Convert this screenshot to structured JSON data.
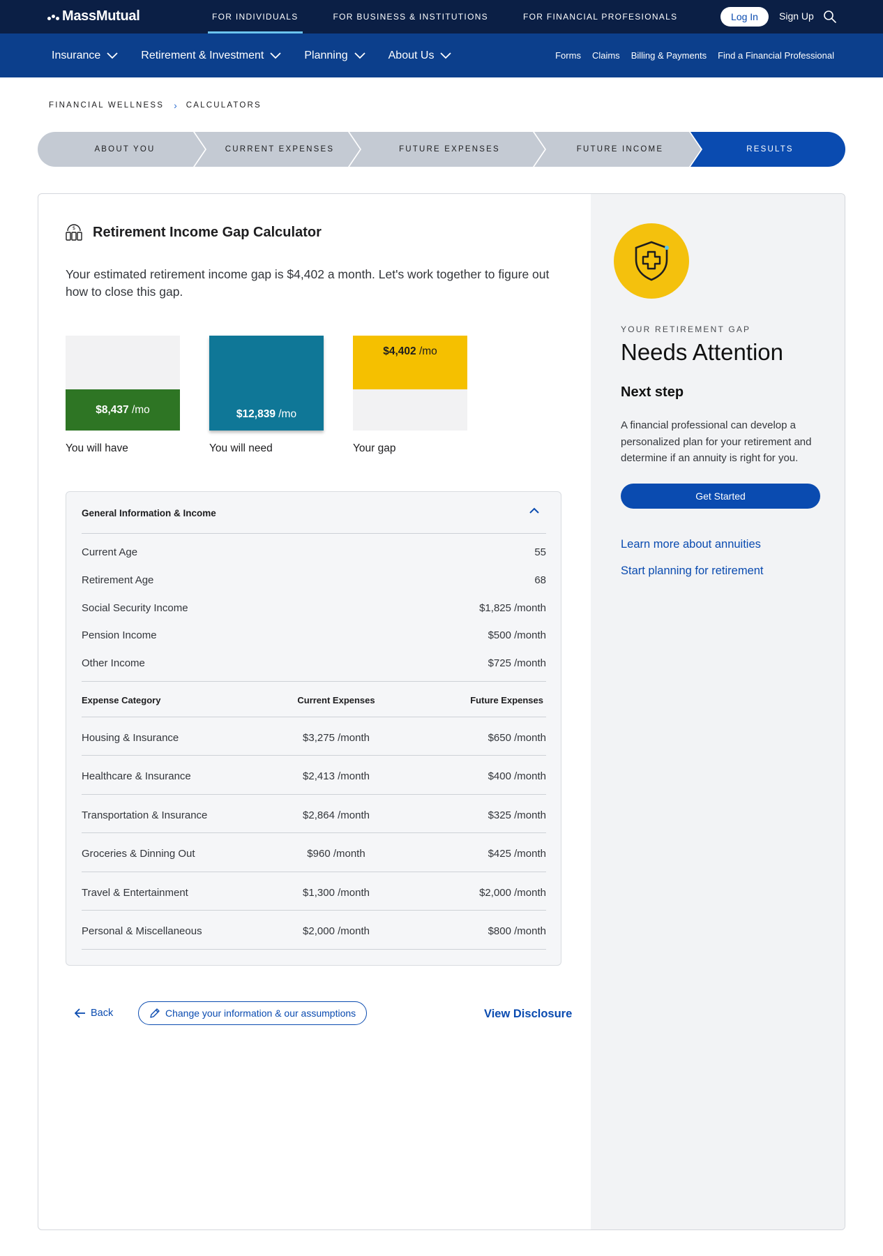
{
  "topbar": {
    "logo": "MassMutual",
    "segments": [
      {
        "label": "FOR INDIVIDUALS",
        "active": true
      },
      {
        "label": "FOR BUSINESS & INSTITUTIONS",
        "active": false
      },
      {
        "label": "FOR FINANCIAL PROFESIONALS",
        "active": false
      }
    ],
    "login_label": "Log In",
    "signup_label": "Sign Up",
    "search_icon": "search-icon"
  },
  "nav": {
    "menus": [
      "Insurance",
      "Retirement & Investment",
      "Planning",
      "About Us"
    ],
    "links": [
      "Forms",
      "Claims",
      "Billing & Payments",
      "Find a Financial Professional"
    ]
  },
  "breadcrumb": [
    "FINANCIAL WELLNESS",
    "CALCULATORS"
  ],
  "stepper": {
    "steps": [
      "ABOUT YOU",
      "CURRENT EXPENSES",
      "FUTURE EXPENSES",
      "FUTURE INCOME",
      "RESULTS"
    ],
    "current": "RESULTS"
  },
  "calculator": {
    "title": "Retirement Income Gap Calculator",
    "intro": "Your estimated retirement income gap is $4,402 a month. Let's work together to figure out how to close this gap.",
    "bars": [
      {
        "value": "$8,437",
        "unit": "/mo",
        "caption": "You will have",
        "color": "#2e7524"
      },
      {
        "value": "$12,839",
        "unit": "/mo",
        "caption": "You will need",
        "color": "#0f7797"
      },
      {
        "value": "$4,402",
        "unit": "/mo",
        "caption": "Your gap",
        "color": "#f5c000"
      }
    ]
  },
  "general": {
    "heading": "General Information & Income",
    "rows": [
      {
        "label": "Current  Age",
        "value": "55"
      },
      {
        "label": "Retirement Age",
        "value": "68"
      },
      {
        "label": "Social Security Income",
        "value": "$1,825 /month"
      },
      {
        "label": "Pension Income",
        "value": "$500 /month"
      },
      {
        "label": "Other Income",
        "value": "$725 /month"
      }
    ]
  },
  "expenses": {
    "headers": [
      "Expense Category",
      "Current Expenses",
      "Future Expenses"
    ],
    "rows": [
      [
        "Housing &  Insurance",
        "$3,275 /month",
        "$650 /month"
      ],
      [
        "Healthcare & Insurance",
        "$2,413 /month",
        "$400 /month"
      ],
      [
        "Transportation & Insurance",
        "$2,864 /month",
        "$325 /month"
      ],
      [
        "Groceries & Dinning Out",
        "$960 /month",
        "$425 /month"
      ],
      [
        "Travel & Entertainment",
        "$1,300 /month",
        "$2,000 /month"
      ],
      [
        "Personal & Miscellaneous",
        "$2,000 /month",
        "$800 /month"
      ]
    ]
  },
  "actions": {
    "back": "Back",
    "change": "Change your information & our assumptions",
    "disclosure": "View Disclosure"
  },
  "side": {
    "badge_icon": "shield-plus-icon",
    "eyebrow": "YOUR RETIREMENT GAP",
    "status": "Needs Attention",
    "next_title": "Next step",
    "next_body": "A financial professional can develop a personalized plan for your retirement and determine if an annuity is right for you.",
    "cta": "Get Started",
    "links": [
      "Learn more about annuities",
      "Start planning for retirement"
    ]
  },
  "colors": {
    "topbar": "#0b1f45",
    "nav": "#0c3f8c",
    "accent": "#0a4bb0",
    "step_inactive": "#c4cad3",
    "gap_yellow": "#f4c10d"
  }
}
